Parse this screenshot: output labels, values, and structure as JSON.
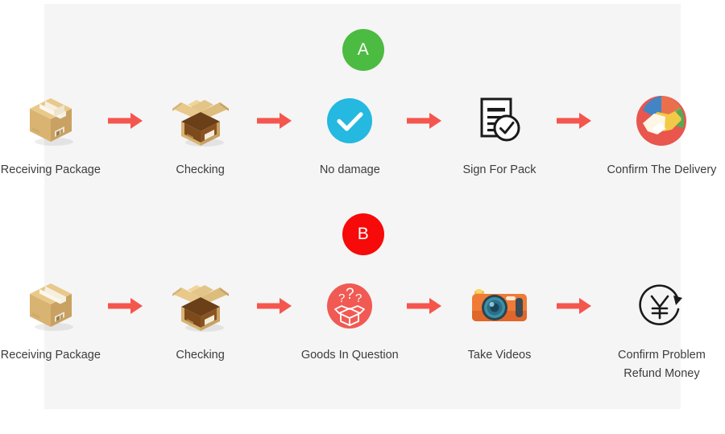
{
  "panel": {
    "background_color": "#f5f5f5",
    "page_background": "#ffffff"
  },
  "colors": {
    "badge_a": "#4cbb41",
    "badge_b": "#f60a0a",
    "arrow": "#f4564e",
    "check_circle": "#25b8e0",
    "question_circle": "#f05a53",
    "camera_body": "#ef7b36",
    "text": "#3d3d3d"
  },
  "flows": [
    {
      "id": "flow-a",
      "badge": "A",
      "badge_color": "#4cbb41",
      "steps": [
        {
          "icon": "closed-box-icon",
          "label": "Receiving Package"
        },
        {
          "icon": "open-box-icon",
          "label": "Checking"
        },
        {
          "icon": "check-circle-icon",
          "label": "No damage"
        },
        {
          "icon": "sign-document-icon",
          "label": "Sign For Pack"
        },
        {
          "icon": "handshake-icon",
          "label": "Confirm The Delivery"
        }
      ]
    },
    {
      "id": "flow-b",
      "badge": "B",
      "badge_color": "#f60a0a",
      "steps": [
        {
          "icon": "closed-box-icon",
          "label": "Receiving Package"
        },
        {
          "icon": "open-box-icon",
          "label": "Checking"
        },
        {
          "icon": "question-box-icon",
          "label": "Goods In Question"
        },
        {
          "icon": "camera-icon",
          "label": "Take Videos"
        },
        {
          "icon": "refund-yen-icon",
          "label": "Confirm Problem\nRefund Money"
        }
      ]
    }
  ],
  "arrow_icon": "arrow-right-icon"
}
